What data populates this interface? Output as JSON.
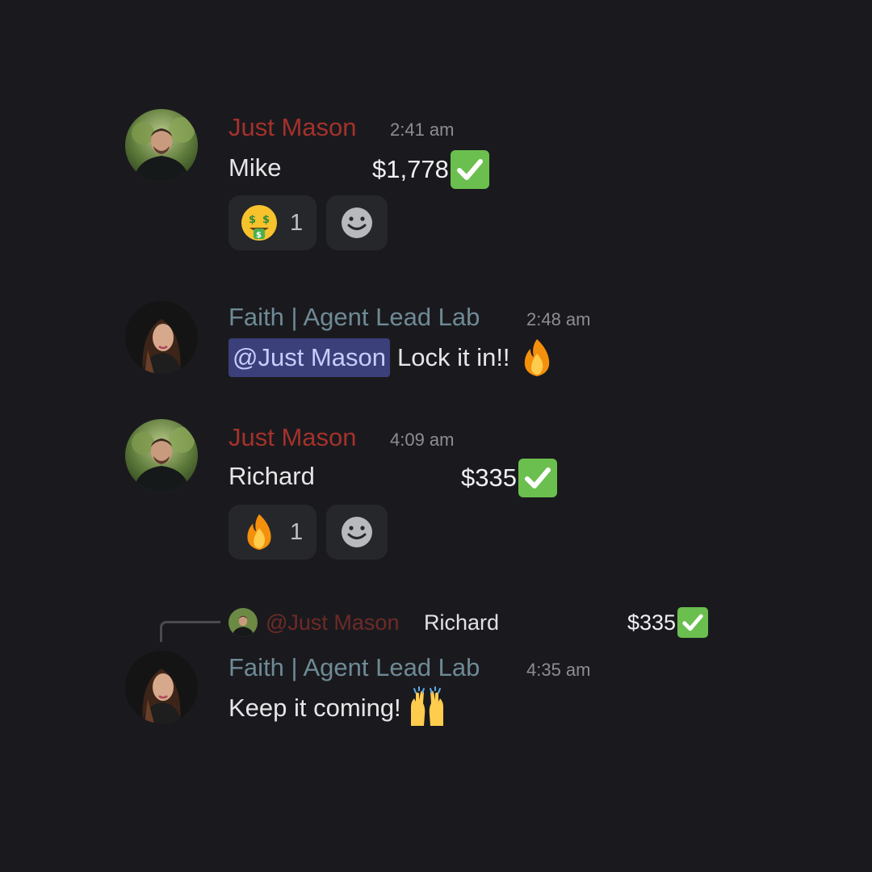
{
  "messages": [
    {
      "author": "Just Mason",
      "time": "2:41 am",
      "name_text": "Mike",
      "amount": "$1,778",
      "reaction": {
        "emoji": "money-mouth-face-icon",
        "count": "1"
      }
    },
    {
      "author": "Faith | Agent Lead Lab",
      "time": "2:48 am",
      "mention": "@Just Mason",
      "text": "Lock it in!!",
      "emoji": "fire-icon"
    },
    {
      "author": "Just Mason",
      "time": "4:09 am",
      "name_text": "Richard",
      "amount": "$335",
      "reaction": {
        "emoji": "fire-icon",
        "count": "1"
      }
    },
    {
      "reply": {
        "mention": "@Just Mason",
        "name_text": "Richard",
        "amount": "$335"
      },
      "author": "Faith | Agent Lead Lab",
      "time": "4:35 am",
      "text": "Keep it coming!",
      "emoji": "raising-hands-icon"
    }
  ],
  "colors": {
    "background": "#1a1a1e",
    "mason_name": "#a5312b",
    "faith_name": "#6e8a95",
    "mention_bg": "#3b3f7a",
    "check_green": "#6bbf4e"
  }
}
